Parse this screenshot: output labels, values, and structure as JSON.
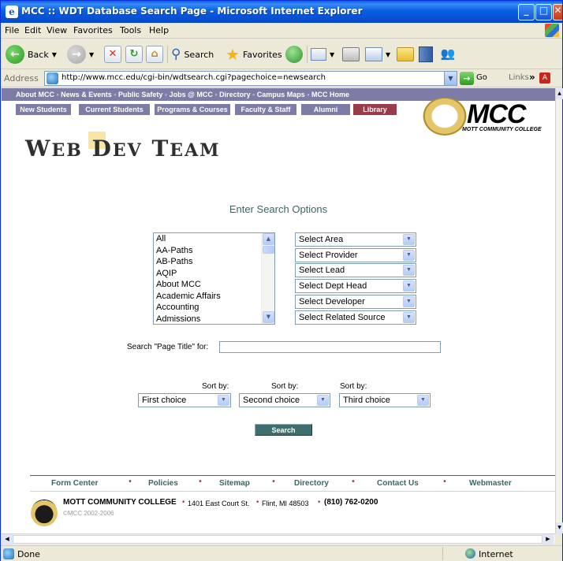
{
  "window": {
    "title": "MCC :: WDT Database Search Page - Microsoft Internet Explorer"
  },
  "menu": [
    "File",
    "Edit",
    "View",
    "Favorites",
    "Tools",
    "Help"
  ],
  "toolbar": {
    "back_label": "Back",
    "search_label": "Search",
    "favorites_label": "Favorites"
  },
  "address": {
    "label": "Address",
    "url": "http://www.mcc.edu/cgi-bin/wdtsearch.cgi?pagechoice=newsearch",
    "go_label": "Go",
    "links_label": "Links"
  },
  "site": {
    "topnav": "About MCC  ◦  News & Events  ◦  Public Safety  ◦  Jobs @ MCC  ◦  Directory  ◦  Campus Maps  ◦  MCC Home",
    "tabs": [
      "New Students",
      "Current Students",
      "Programs & Courses",
      "Faculty & Staff",
      "Alumni",
      "Library"
    ],
    "logo_text": "MCC",
    "logo_subtitle": "MOTT COMMUNITY COLLEGE",
    "banner": {
      "w": "W",
      "eb": "EB",
      "d": "D",
      "ev": "EV",
      "t": "T",
      "eam": "EAM"
    }
  },
  "form": {
    "heading": "Enter Search Options",
    "categories": [
      "All",
      "AA-Paths",
      "AB-Paths",
      "AQIP",
      "About MCC",
      "Academic Affairs",
      "Accounting",
      "Admissions"
    ],
    "selects": [
      "Select Area",
      "Select Provider",
      "Select Lead",
      "Select Dept Head",
      "Select Developer",
      "Select Related Source"
    ],
    "search_label": "Search \"Page Title\" for:",
    "search_value": "",
    "sort_label": "Sort by:",
    "sort1": "First choice",
    "sort2": "Second choice",
    "sort3": "Third choice",
    "search_button": "Search"
  },
  "footer": {
    "links": [
      "Form Center",
      "Policies",
      "Sitemap",
      "Directory",
      "Contact Us",
      "Webmaster"
    ],
    "college": "MOTT COMMUNITY COLLEGE",
    "street": "1401 East Court St.",
    "city": "Flint, MI 48503",
    "phone": "(810) 762-0200",
    "copyright": "©MCC 2002-2006"
  },
  "status": {
    "text": "Done",
    "zone": "Internet"
  }
}
